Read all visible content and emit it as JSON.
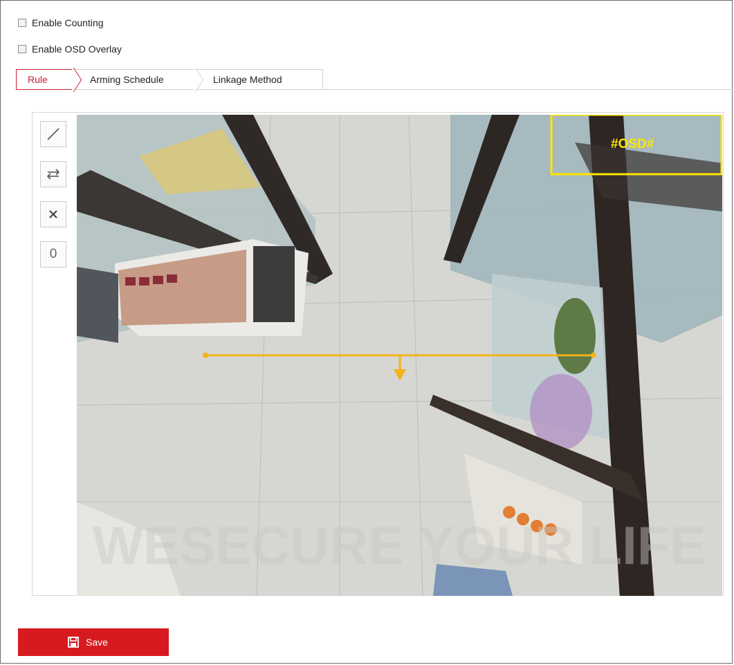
{
  "options": {
    "enable_counting": {
      "label": "Enable Counting",
      "checked": false
    },
    "enable_osd": {
      "label": "Enable OSD Overlay",
      "checked": false
    }
  },
  "tabs": [
    {
      "label": "Rule",
      "active": true
    },
    {
      "label": "Arming Schedule",
      "active": false
    },
    {
      "label": "Linkage Method",
      "active": false
    }
  ],
  "toolbar": {
    "draw_line": {
      "icon": "line-icon"
    },
    "swap_direction": {
      "icon": "swap-arrows-icon"
    },
    "clear": {
      "icon": "close-icon"
    },
    "count": {
      "label": "0"
    }
  },
  "video": {
    "osd_text": "#OSD#",
    "osd_color": "#ffdf00",
    "line_color": "#f2b31c",
    "watermark_text": "WESECURE YOUR LIFE"
  },
  "actions": {
    "save_label": "Save",
    "save_color": "#d71920"
  }
}
